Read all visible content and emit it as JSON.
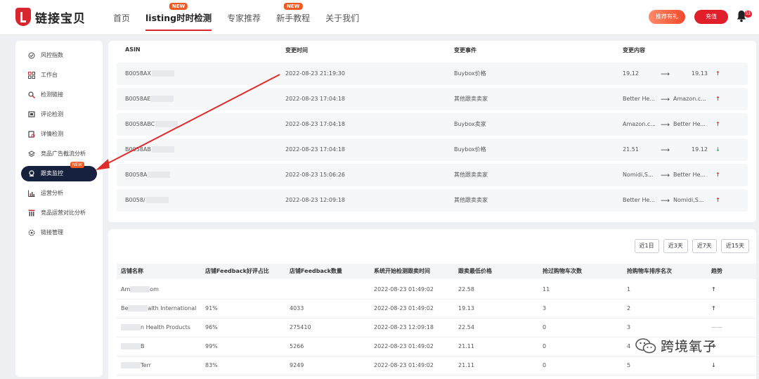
{
  "header": {
    "logo_text": "链接宝贝",
    "nav": [
      {
        "label": "首页",
        "badge": ""
      },
      {
        "label": "listing时时检测",
        "badge": "NEW"
      },
      {
        "label": "专家推荐",
        "badge": ""
      },
      {
        "label": "新手教程",
        "badge": "NEW"
      },
      {
        "label": "关于我们",
        "badge": ""
      }
    ],
    "recommend_btn": "推荐有礼",
    "recharge_btn": "充值",
    "bell_count": "53"
  },
  "sidebar": {
    "items": [
      {
        "label": "风控指数",
        "icon": "shield-icon"
      },
      {
        "label": "工作台",
        "icon": "grid-icon"
      },
      {
        "label": "检测链接",
        "icon": "search-link-icon"
      },
      {
        "label": "评论检测",
        "icon": "comment-icon"
      },
      {
        "label": "详情检测",
        "icon": "detail-icon"
      },
      {
        "label": "竞品广告截流分析",
        "icon": "layers-icon"
      },
      {
        "label": "跟卖监控",
        "icon": "monitor-icon",
        "badge": "NEW"
      },
      {
        "label": "运营分析",
        "icon": "bar-chart-icon"
      },
      {
        "label": "竞品运营对比分析",
        "icon": "compare-icon"
      },
      {
        "label": "链接管理",
        "icon": "settings-icon"
      }
    ]
  },
  "change_table": {
    "headers": [
      "ASIN",
      "变更时间",
      "变更事件",
      "变更内容"
    ],
    "rows": [
      {
        "asin": "B0058AX",
        "time": "2022-08-23 21:19:30",
        "event": "Buybox价格",
        "from": "19.12",
        "to": "19.13",
        "trend": "up"
      },
      {
        "asin": "B0058AE",
        "time": "2022-08-23 17:04:18",
        "event": "其他跟卖卖家",
        "from": "Better He...",
        "to": "Amazon.c...",
        "trend": "up"
      },
      {
        "asin": "B0058ABC",
        "time": "2022-08-23 17:04:18",
        "event": "Buybox卖家",
        "from": "Amazon.c...",
        "to": "Better He...",
        "trend": "up"
      },
      {
        "asin": "B0058AB",
        "time": "2022-08-23 17:04:18",
        "event": "Buybox价格",
        "from": "21.51",
        "to": "19.12",
        "trend": "down"
      },
      {
        "asin": "B0058A",
        "time": "2022-08-23 15:06:26",
        "event": "其他跟卖卖家",
        "from": "Nomidi,S...",
        "to": "Better He...",
        "trend": "up"
      },
      {
        "asin": "B0058/",
        "time": "2022-08-23 12:09:18",
        "event": "其他跟卖卖家",
        "from": "Better He...",
        "to": "Nomidi,S...",
        "trend": "up"
      }
    ]
  },
  "range_buttons": [
    "近1日",
    "近3天",
    "近7天",
    "近15天"
  ],
  "seller_table": {
    "headers": [
      "店铺名称",
      "店铺Feedback好评占比",
      "店铺Feedback数量",
      "系统开始检测跟卖时间",
      "跟卖最低价格",
      "抢过购物车次数",
      "抢购物车排序名次",
      "趋势"
    ],
    "rows": [
      {
        "name_a": "Am",
        "name_b": "om",
        "ratio": "",
        "count": "",
        "start": "2022-08-23 01:49:02",
        "price": "22.58",
        "times": "11",
        "rank": "1",
        "trend": "up"
      },
      {
        "name_a": "Be",
        "name_b": "alth International",
        "ratio": "91%",
        "count": "4033",
        "start": "2022-08-23 01:49:02",
        "price": "19.13",
        "times": "3",
        "rank": "2",
        "trend": "up"
      },
      {
        "name_a": "",
        "name_b": "n Health Products",
        "ratio": "96%",
        "count": "275410",
        "start": "2022-08-23 12:09:18",
        "price": "22.54",
        "times": "0",
        "rank": "3",
        "trend": "flat"
      },
      {
        "name_a": "",
        "name_b": "B",
        "ratio": "99%",
        "count": "5266",
        "start": "2022-08-23 01:49:02",
        "price": "21.11",
        "times": "0",
        "rank": "4",
        "trend": "up"
      },
      {
        "name_a": "",
        "name_b": "Terr",
        "ratio": "83%",
        "count": "9249",
        "start": "2022-08-23 01:49:02",
        "price": "21.11",
        "times": "0",
        "rank": "5",
        "trend": "down"
      }
    ]
  },
  "watermark": "跨境氧子",
  "colors": {
    "brand": "#d9262e",
    "sidebar_active": "#16213e",
    "up": "#e0302c",
    "down": "#2fa84f",
    "annotation": "#e02b2b"
  }
}
